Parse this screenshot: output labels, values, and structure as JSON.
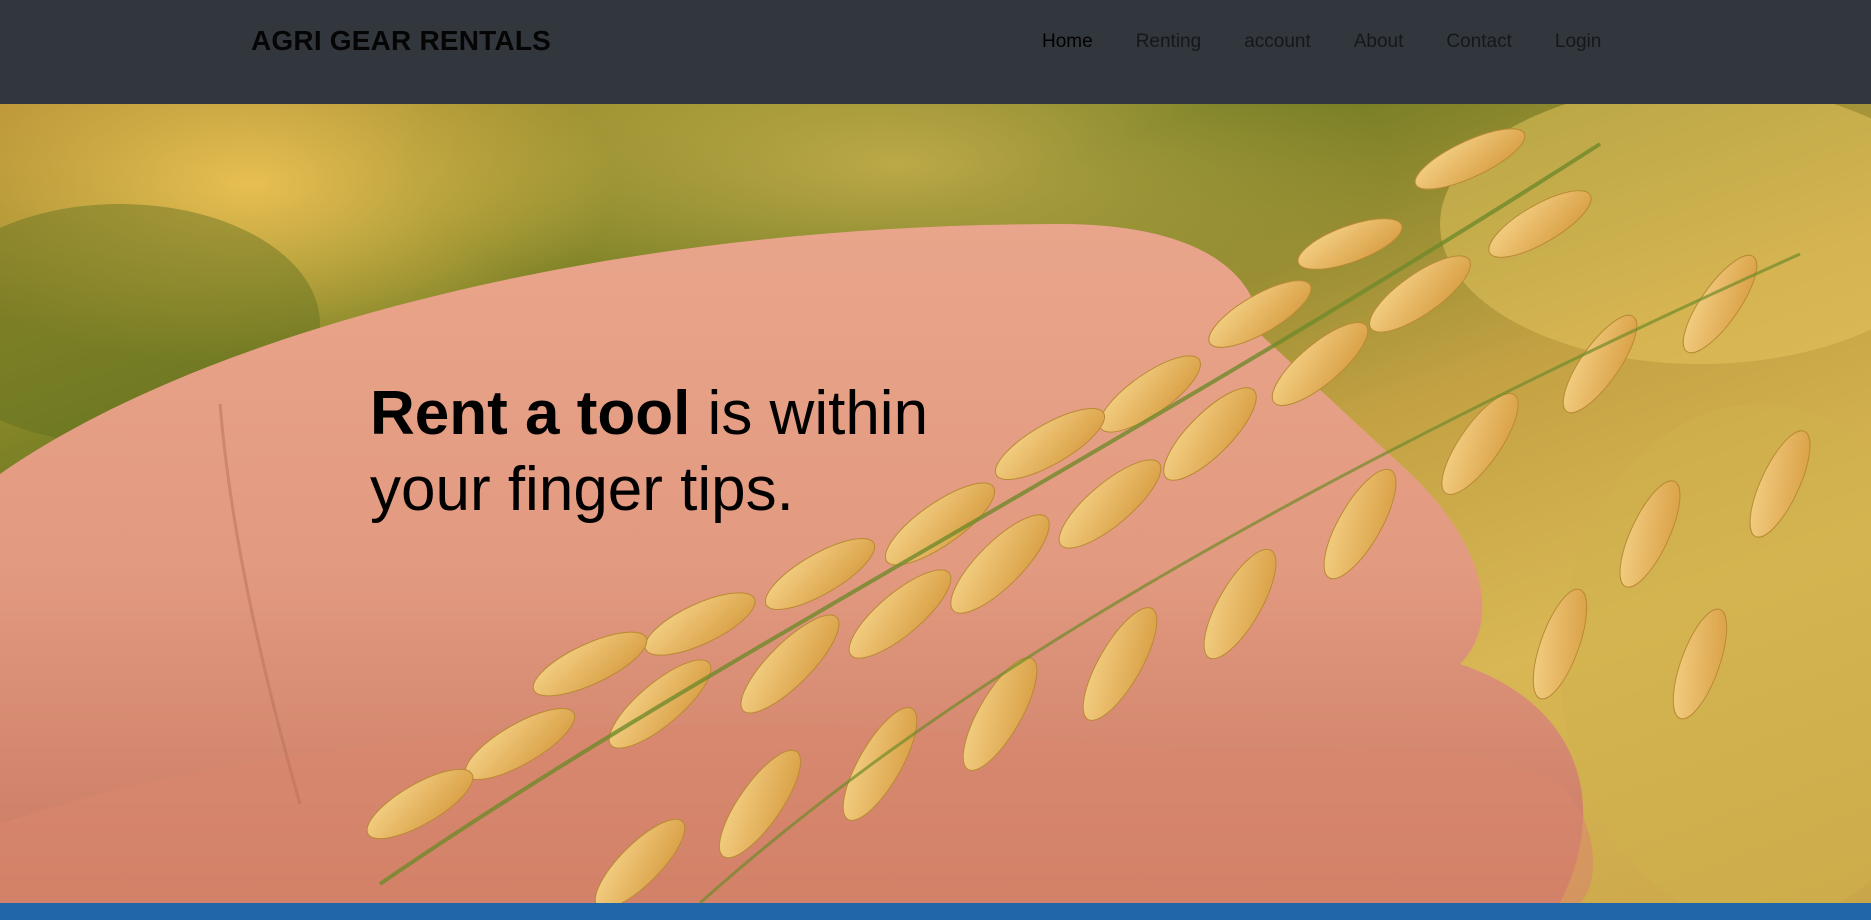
{
  "brand": {
    "name": "AGRI GEAR RENTALS"
  },
  "nav": {
    "items": [
      {
        "label": "Home",
        "active": true
      },
      {
        "label": "Renting",
        "active": false
      },
      {
        "label": "account",
        "active": false
      },
      {
        "label": "About",
        "active": false
      },
      {
        "label": "Contact",
        "active": false
      },
      {
        "label": "Login",
        "active": false
      }
    ]
  },
  "hero": {
    "headline_bold": "Rent a tool",
    "headline_rest_line1": " is within",
    "headline_line2": "your finger tips."
  },
  "colors": {
    "navbar_bg": "#32373d",
    "bottom_strip": "#2166a8",
    "text_dark": "#000000"
  }
}
